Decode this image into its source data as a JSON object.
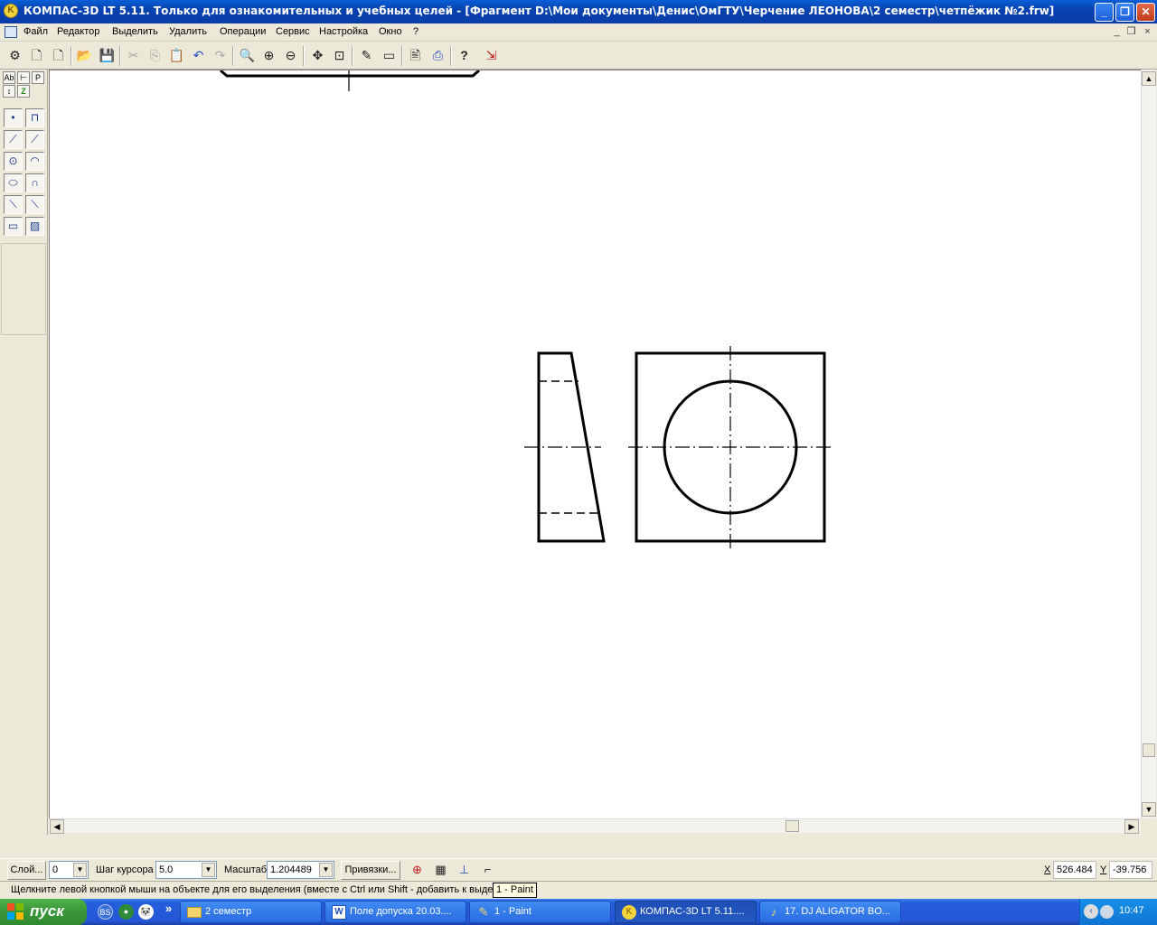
{
  "window": {
    "title": "КОМПАС-3D LT 5.11. Только для ознакомительных и учебных целей - [Фрагмент D:\\Мои документы\\Денис\\ОмГТУ\\Черчение ЛЕОНОВА\\2 семестр\\четпёжик №2.frw]",
    "app_icon": "kompas-icon",
    "controls": {
      "minimize": "_",
      "restore": "❐",
      "close": "✕"
    }
  },
  "menu": {
    "items": [
      "Файл",
      "Редактор",
      "Выделить",
      "Удалить",
      "Операции",
      "Сервис",
      "Настройка",
      "Окно",
      "?"
    ],
    "mdi_controls": {
      "minimize": "_",
      "restore": "❐",
      "close": "×"
    }
  },
  "toolbar": {
    "buttons": [
      {
        "icon": "settings-icon",
        "glyph": "⚙"
      },
      {
        "icon": "new-document-icon",
        "glyph": "🗋"
      },
      {
        "icon": "new-fragment-icon",
        "glyph": "🗋"
      },
      {
        "icon": "open-icon",
        "glyph": "📂"
      },
      {
        "icon": "save-icon",
        "glyph": "💾"
      },
      {
        "icon": "cut-icon",
        "glyph": "✂"
      },
      {
        "icon": "copy-icon",
        "glyph": "⎘"
      },
      {
        "icon": "paste-icon",
        "glyph": "📋"
      },
      {
        "icon": "undo-icon",
        "glyph": "↶"
      },
      {
        "icon": "redo-icon",
        "glyph": "↷"
      },
      {
        "icon": "zoom-icon",
        "glyph": "🔍"
      },
      {
        "icon": "zoom-in-icon",
        "glyph": "⊕"
      },
      {
        "icon": "zoom-out-icon",
        "glyph": "⊖"
      },
      {
        "icon": "pan-icon",
        "glyph": "✥"
      },
      {
        "icon": "zoom-all-icon",
        "glyph": "⊡"
      },
      {
        "icon": "refresh-icon",
        "glyph": "✎"
      },
      {
        "icon": "view-icon",
        "glyph": "▭"
      },
      {
        "icon": "preview-icon",
        "glyph": "🖹"
      },
      {
        "icon": "print-icon",
        "glyph": "⎙"
      },
      {
        "icon": "help-icon",
        "glyph": "?"
      },
      {
        "icon": "exit-icon",
        "glyph": "⇲"
      }
    ]
  },
  "palette": {
    "tabs": [
      "Ab",
      "⊢",
      "P",
      "↕",
      "Z"
    ],
    "buttons": [
      {
        "icon": "point-icon",
        "glyph": "•"
      },
      {
        "icon": "aux-line-icon",
        "glyph": "⊓"
      },
      {
        "icon": "segment-icon",
        "glyph": "⟋"
      },
      {
        "icon": "line-icon",
        "glyph": "⟋"
      },
      {
        "icon": "circle-icon",
        "glyph": "⊙"
      },
      {
        "icon": "arc-icon",
        "glyph": "◠"
      },
      {
        "icon": "ellipse-icon",
        "glyph": "⬭"
      },
      {
        "icon": "bezier-icon",
        "glyph": "∩"
      },
      {
        "icon": "chamfer-icon",
        "glyph": "⟍"
      },
      {
        "icon": "fillet-icon",
        "glyph": "⟍"
      },
      {
        "icon": "rectangle-icon",
        "glyph": "▭"
      },
      {
        "icon": "hatch-icon",
        "glyph": "▨"
      }
    ]
  },
  "properties": {
    "layer_button": "Слой...",
    "layer_value": "0",
    "cursor_step_label": "Шаг курсора",
    "cursor_step_value": "5.0",
    "scale_label": "Масштаб",
    "scale_value": "1.204489",
    "snaps_button": "Привязки...",
    "x_label": "X",
    "x_value": "526.484",
    "y_label": "Y",
    "y_value": "-39.756"
  },
  "status": {
    "text": "Щелкните левой кнопкой мыши на объекте для его выделения (вместе с Ctrl или Shift - добавить к выде",
    "tooltip": "1 - Paint"
  },
  "taskbar": {
    "start_label": "пуск",
    "quick_launch": [
      {
        "icon": "bs-icon",
        "glyph": "BS",
        "color": "#3a6fd8"
      },
      {
        "icon": "browser-icon",
        "glyph": "●",
        "color": "#2e8b3a"
      },
      {
        "icon": "panda-icon",
        "glyph": "🐼",
        "color": "#ffffff"
      },
      {
        "icon": "more-icon",
        "glyph": "»",
        "color": "transparent"
      }
    ],
    "buttons": [
      {
        "label": "2 семестр",
        "icon": "folder-icon",
        "active": false
      },
      {
        "label": "Поле допуска 20.03....",
        "icon": "word-icon",
        "active": false
      },
      {
        "label": "1 - Paint",
        "icon": "paint-icon",
        "active": false
      },
      {
        "label": "КОМПАС-3D LT 5.11....",
        "icon": "kompas-icon",
        "active": true
      },
      {
        "label": "17. DJ ALIGATOR BO...",
        "icon": "player-icon",
        "active": false
      }
    ],
    "clock": "10:47"
  }
}
